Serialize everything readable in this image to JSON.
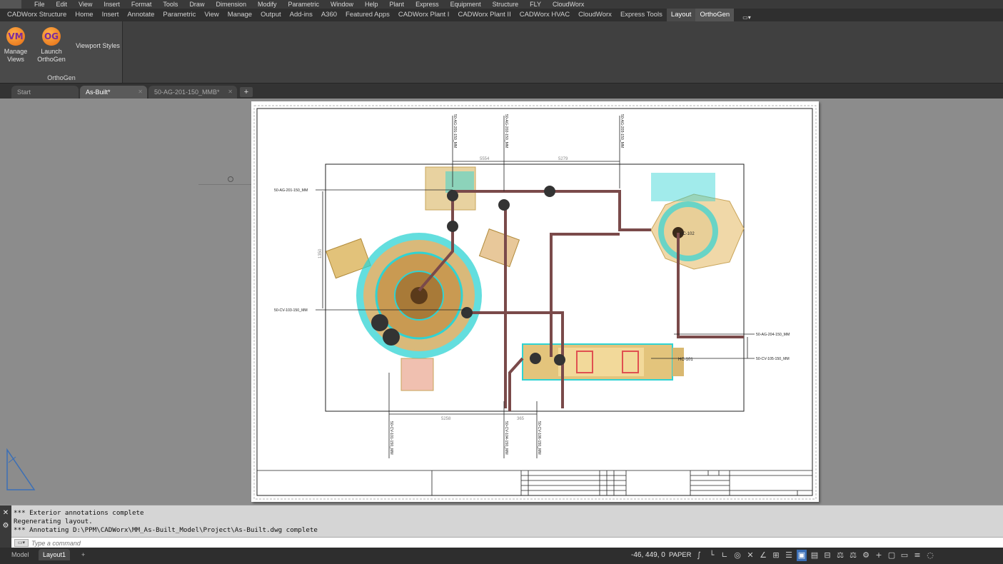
{
  "menu": [
    "File",
    "Edit",
    "View",
    "Insert",
    "Format",
    "Tools",
    "Draw",
    "Dimension",
    "Modify",
    "Parametric",
    "Window",
    "Help",
    "Plant",
    "Express",
    "Equipment",
    "Structure",
    "FLY",
    "CloudWorx"
  ],
  "ribbon_tabs": [
    "CADWorx Structure",
    "Home",
    "Insert",
    "Annotate",
    "Parametric",
    "View",
    "Manage",
    "Output",
    "Add-ins",
    "A360",
    "Featured Apps",
    "CADWorx Plant I",
    "CADWorx Plant II",
    "CADWorx HVAC",
    "CloudWorx",
    "Express Tools",
    "Layout",
    "OrthoGen"
  ],
  "ribbon": {
    "manage_views": {
      "icon_text": "VM",
      "label1": "Manage",
      "label2": "Views"
    },
    "launch_orthogen": {
      "icon_text": "OG",
      "label1": "Launch",
      "label2": "OrthoGen"
    },
    "viewport_styles": "Viewport Styles",
    "panel_title": "OrthoGen"
  },
  "file_tabs": [
    {
      "label": "Start"
    },
    {
      "label": "As-Built*"
    },
    {
      "label": "50-AG-201-150_MMB*"
    }
  ],
  "drawing": {
    "dims": [
      "5554",
      "5279",
      "2550",
      "5258",
      "365",
      "1350"
    ],
    "labels": [
      "50-AG-201-150_MM",
      "50-CV-103-150_MM",
      "50-AG-202-150_MM",
      "50-CV-101-150_MM",
      "50-CV-105-150_MM",
      "50-AG-204-150_MM",
      "50-AG-203-150_MM",
      "50-CV-106-150_MM",
      "50-AG-201-150_MM",
      "50-CV-104-150_MM",
      "HC-101",
      "HC-102"
    ]
  },
  "command": {
    "lines": [
      "*** Exterior annotations complete",
      "Regenerating layout.",
      "*** Annotating D:\\PPM\\CADWorx\\MM_As-Built_Model\\Project\\As-Built.dwg complete"
    ],
    "placeholder": "Type a command"
  },
  "status": {
    "layout_tabs": [
      "Model",
      "Layout1"
    ],
    "coords": "-46, 449, 0",
    "space": "PAPER"
  },
  "colors": {
    "pipe": "#7a4a4a",
    "cyan": "#2fd3d3",
    "tan": "#c9a55a",
    "accent": "#3b6fb6"
  }
}
